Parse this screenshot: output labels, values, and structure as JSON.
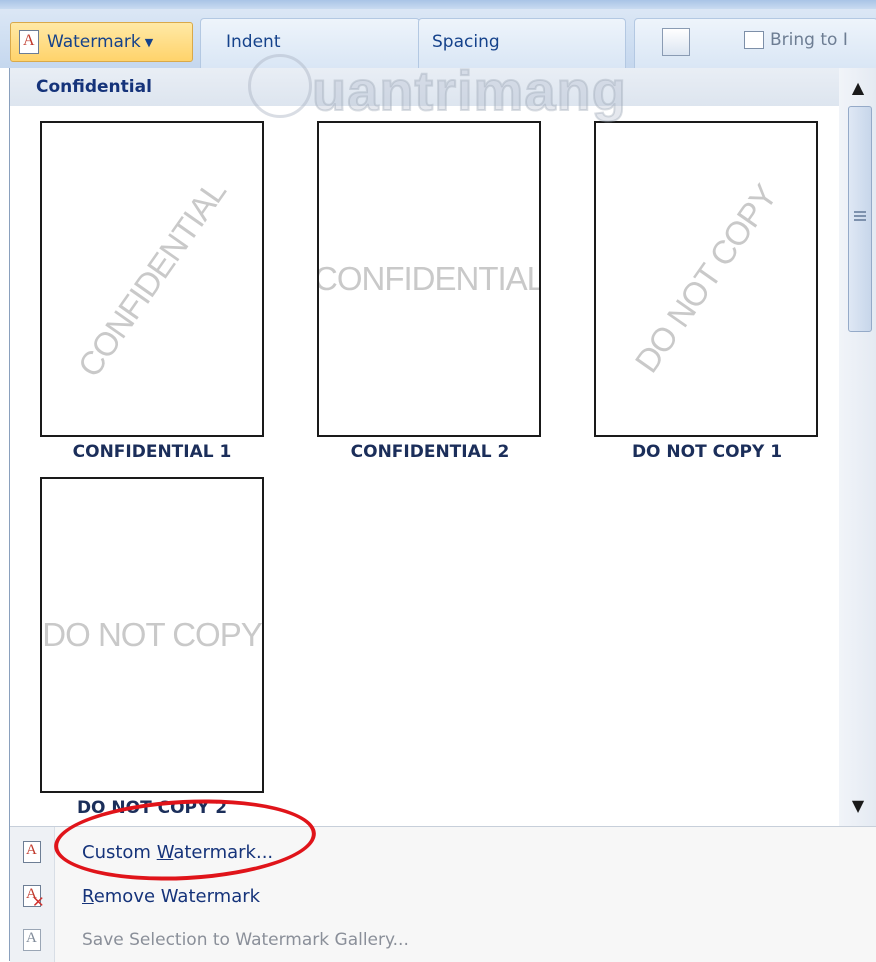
{
  "ribbon": {
    "watermark_label": "Watermark",
    "indent_label": "Indent",
    "spacing_label": "Spacing",
    "bring_to_label": "Bring to I"
  },
  "panel": {
    "header": "Confidential",
    "items": [
      {
        "watermark_text": "CONFIDENTIAL",
        "caption": "CONFIDENTIAL 1",
        "orientation": "diagonal"
      },
      {
        "watermark_text": "CONFIDENTIAL",
        "caption": "CONFIDENTIAL 2",
        "orientation": "horizontal"
      },
      {
        "watermark_text": "DO NOT COPY",
        "caption": "DO NOT COPY 1",
        "orientation": "diagonal"
      },
      {
        "watermark_text": "DO NOT COPY",
        "caption": "DO NOT COPY 2",
        "orientation": "horizontal"
      }
    ]
  },
  "menu": {
    "custom_prefix": "Custom ",
    "custom_underlined": "W",
    "custom_suffix": "atermark...",
    "remove_underlined": "R",
    "remove_suffix": "emove Watermark",
    "save_label": "Save Selection to Watermark Gallery..."
  },
  "brand": "uantrimang",
  "colors": {
    "highlight": "#e0141a",
    "accent_button": "#ffd36b",
    "label_text": "#15337a"
  }
}
